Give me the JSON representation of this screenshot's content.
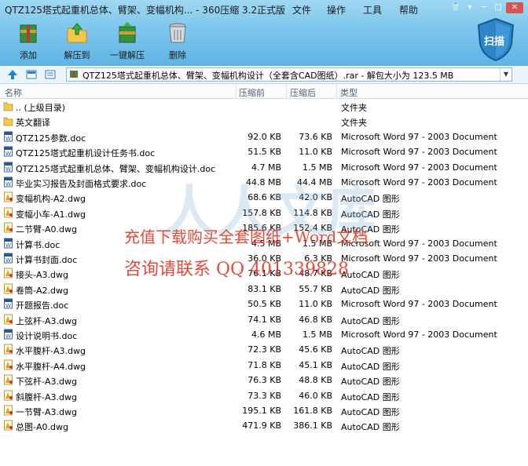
{
  "window": {
    "title": "QTZ125塔式起重机总体、臂架、变幅机构... - 360压缩 3.2正式版",
    "menu": [
      "文件",
      "操作",
      "工具",
      "帮助"
    ]
  },
  "toolbar": {
    "add": "添加",
    "extract_to": "解压到",
    "one_click_extract": "一键解压",
    "delete": "删除",
    "scan": "扫描"
  },
  "address": {
    "path": "QTZ125塔式起重机总体、臂架、变幅机构设计（全套含CAD图纸）.rar - 解包大小为 123.5 MB"
  },
  "columns": {
    "name": "名称",
    "packed": "压缩前",
    "unpacked": "压缩后",
    "type": "类型"
  },
  "files": [
    {
      "name": ".. (上级目录)",
      "before": "",
      "after": "",
      "type": "文件夹",
      "icon": "folder-up-icon"
    },
    {
      "name": "英文翻译",
      "before": "",
      "after": "",
      "type": "文件夹",
      "icon": "folder-icon"
    },
    {
      "name": "QTZ125参数.doc",
      "before": "92.0 KB",
      "after": "73.6 KB",
      "type": "Microsoft Word 97 - 2003 Document",
      "icon": "word-doc-icon"
    },
    {
      "name": "QTZ125塔式起重机设计任务书.doc",
      "before": "51.5 KB",
      "after": "11.0 KB",
      "type": "Microsoft Word 97 - 2003 Document",
      "icon": "word-doc-icon"
    },
    {
      "name": "QTZ125塔式起重机总体、臂架、变幅机构设计.doc",
      "before": "4.7 MB",
      "after": "1.5 MB",
      "type": "Microsoft Word 97 - 2003 Document",
      "icon": "word-doc-icon"
    },
    {
      "name": "毕业实习报告及封面格式要求.doc",
      "before": "44.8 MB",
      "after": "44.4 MB",
      "type": "Microsoft Word 97 - 2003 Document",
      "icon": "word-doc-icon"
    },
    {
      "name": "变幅机构-A2.dwg",
      "before": "68.6 KB",
      "after": "42.0 KB",
      "type": "AutoCAD 图形",
      "icon": "dwg-icon"
    },
    {
      "name": "变幅小车-A1.dwg",
      "before": "157.8 KB",
      "after": "114.8 KB",
      "type": "AutoCAD 图形",
      "icon": "dwg-icon"
    },
    {
      "name": "二节臂-A0.dwg",
      "before": "185.6 KB",
      "after": "152.4 KB",
      "type": "AutoCAD 图形",
      "icon": "dwg-icon"
    },
    {
      "name": "计算书.doc",
      "before": "4.5 MB",
      "after": "1.5 MB",
      "type": "Microsoft Word 97 - 2003 Document",
      "icon": "word-doc-icon"
    },
    {
      "name": "计算书封面.doc",
      "before": "36.0 KB",
      "after": "6.3 KB",
      "type": "Microsoft Word 97 - 2003 Document",
      "icon": "word-doc-icon"
    },
    {
      "name": "接头-A3.dwg",
      "before": "76.1 KB",
      "after": "48.7 KB",
      "type": "AutoCAD 图形",
      "icon": "dwg-icon"
    },
    {
      "name": "卷筒-A2.dwg",
      "before": "83.1 KB",
      "after": "55.7 KB",
      "type": "AutoCAD 图形",
      "icon": "dwg-icon"
    },
    {
      "name": "开题报告.doc",
      "before": "50.5 KB",
      "after": "11.0 KB",
      "type": "Microsoft Word 97 - 2003 Document",
      "icon": "word-doc-icon"
    },
    {
      "name": "上弦杆-A3.dwg",
      "before": "74.1 KB",
      "after": "46.8 KB",
      "type": "AutoCAD 图形",
      "icon": "dwg-icon"
    },
    {
      "name": "设计说明书.doc",
      "before": "4.6 MB",
      "after": "1.5 MB",
      "type": "Microsoft Word 97 - 2003 Document",
      "icon": "word-doc-icon"
    },
    {
      "name": "水平腹杆-A3.dwg",
      "before": "72.3 KB",
      "after": "45.6 KB",
      "type": "AutoCAD 图形",
      "icon": "dwg-icon"
    },
    {
      "name": "水平腹杆-A4.dwg",
      "before": "71.8 KB",
      "after": "45.1 KB",
      "type": "AutoCAD 图形",
      "icon": "dwg-icon"
    },
    {
      "name": "下弦杆-A3.dwg",
      "before": "76.3 KB",
      "after": "48.8 KB",
      "type": "AutoCAD 图形",
      "icon": "dwg-icon"
    },
    {
      "name": "斜腹杆-A3.dwg",
      "before": "73.3 KB",
      "after": "46.0 KB",
      "type": "AutoCAD 图形",
      "icon": "dwg-icon"
    },
    {
      "name": "一节臂-A3.dwg",
      "before": "195.1 KB",
      "after": "161.8 KB",
      "type": "AutoCAD 图形",
      "icon": "dwg-icon"
    },
    {
      "name": "总图-A0.dwg",
      "before": "471.9 KB",
      "after": "386.1 KB",
      "type": "AutoCAD 图形",
      "icon": "dwg-icon"
    }
  ],
  "watermark": {
    "line1": "充值下载购买全套图纸+Word文档",
    "line2": "咨询请联系  QQ 401339828"
  },
  "colors": {
    "chrome": "#7cc6ec",
    "watermark": "#e23b2a",
    "header_text": "#4a5f73"
  }
}
